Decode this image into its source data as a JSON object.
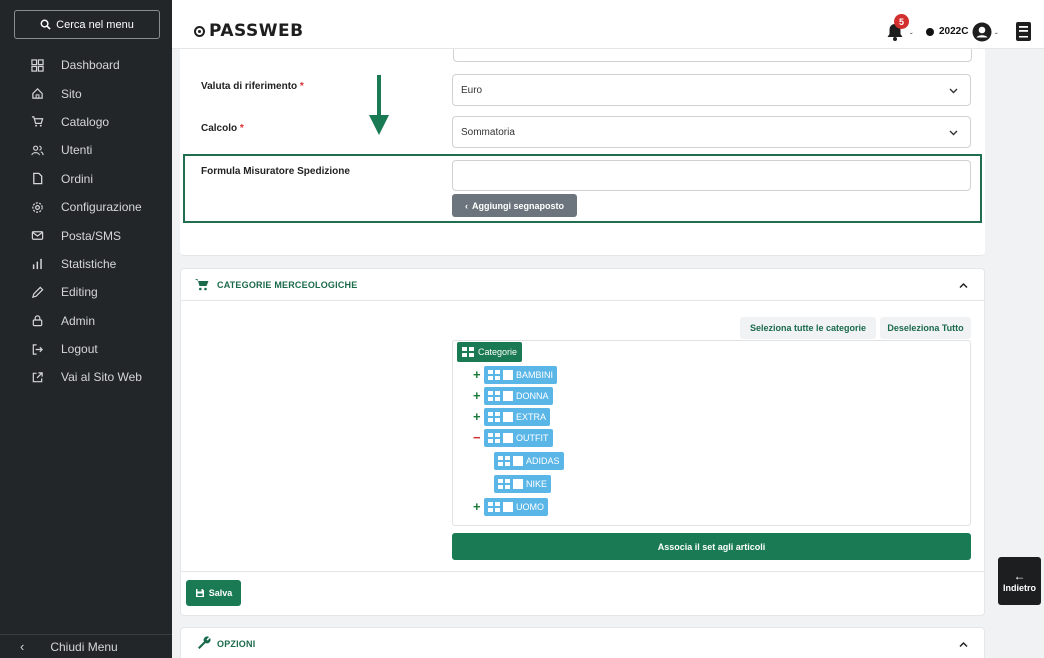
{
  "sidebar": {
    "search_label": "Cerca nel menu",
    "items": [
      {
        "label": "Dashboard",
        "icon": "dashboard-icon"
      },
      {
        "label": "Sito",
        "icon": "home-icon"
      },
      {
        "label": "Catalogo",
        "icon": "cart-icon"
      },
      {
        "label": "Utenti",
        "icon": "users-icon"
      },
      {
        "label": "Ordini",
        "icon": "document-icon"
      },
      {
        "label": "Configurazione",
        "icon": "gear-icon"
      },
      {
        "label": "Posta/SMS",
        "icon": "mail-icon"
      },
      {
        "label": "Statistiche",
        "icon": "bar-chart-icon"
      },
      {
        "label": "Editing",
        "icon": "pencil-icon"
      },
      {
        "label": "Admin",
        "icon": "lock-icon"
      },
      {
        "label": "Logout",
        "icon": "logout-icon"
      },
      {
        "label": "Vai al Sito Web",
        "icon": "external-link-icon"
      }
    ],
    "close_label": "Chiudi Menu"
  },
  "header": {
    "logo": "PASSWEB",
    "notifications_count": "5",
    "user_code": "2022C"
  },
  "form": {
    "currency_label": "Valuta di riferimento",
    "currency_value": "Euro",
    "calc_label": "Calcolo",
    "calc_value": "Sommatoria",
    "required_mark": "*",
    "formula_label": "Formula Misuratore Spedizione",
    "formula_value": "",
    "add_placeholder_label": "Aggiungi segnaposto",
    "add_placeholder_prefix": "‹"
  },
  "categories": {
    "title": "CATEGORIE MERCEOLOGICHE",
    "select_all_label": "Seleziona tutte le categorie",
    "deselect_all_label": "Deseleziona Tutto",
    "root_label": "Categorie",
    "nodes": [
      {
        "label": "BAMBINI",
        "toggle": "+"
      },
      {
        "label": "DONNA",
        "toggle": "+"
      },
      {
        "label": "EXTRA",
        "toggle": "+"
      },
      {
        "label": "OUTFIT",
        "toggle": "−"
      },
      {
        "label": "ADIDAS",
        "toggle": ""
      },
      {
        "label": "NIKE",
        "toggle": ""
      },
      {
        "label": "UOMO",
        "toggle": "+"
      }
    ],
    "assign_label": "Associa il set agli articoli"
  },
  "save_label": "Salva",
  "options_title": "OPZIONI",
  "back_label": "Indietro",
  "colors": {
    "accent_green": "#1a7a53",
    "tree_blue": "#5bb6e8",
    "sidebar_bg": "#232629",
    "required_red": "#d32f2f"
  }
}
